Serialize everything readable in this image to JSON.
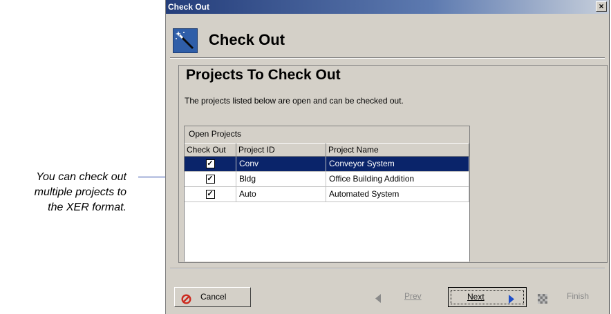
{
  "annotation": {
    "lines": [
      "You can check out",
      "multiple projects to",
      "the XER format."
    ]
  },
  "window": {
    "title": "Check Out",
    "close_glyph": "×"
  },
  "header": {
    "title": "Check Out",
    "icon": "wizard-wand-icon"
  },
  "panel": {
    "title": "Projects To Check Out",
    "description": "The projects listed below are open and can be checked out."
  },
  "grid": {
    "group_label": "Open Projects",
    "columns": [
      "Check Out",
      "Project ID",
      "Project Name"
    ],
    "rows": [
      {
        "checked": true,
        "check_glyph": "✓",
        "id": "Conv",
        "name": "Conveyor System",
        "selected": true
      },
      {
        "checked": true,
        "check_glyph": "✓",
        "id": "Bldg",
        "name": "Office Building Addition",
        "selected": false
      },
      {
        "checked": true,
        "check_glyph": "✓",
        "id": "Auto",
        "name": "Automated System",
        "selected": false
      }
    ]
  },
  "buttons": {
    "cancel": "Cancel",
    "prev": "Prev",
    "next": "Next",
    "finish": "Finish"
  },
  "colors": {
    "selection": "#0a246a",
    "annotation_line": "#1f3fa3",
    "cancel_icon": "#cc2a1f"
  }
}
